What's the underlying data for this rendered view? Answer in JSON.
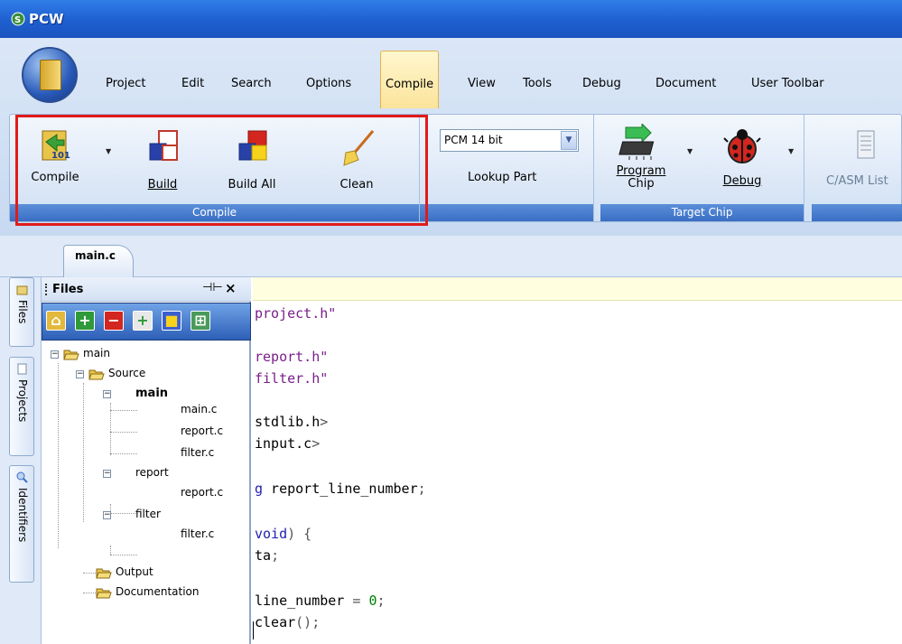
{
  "window": {
    "title": "PCW"
  },
  "menu": {
    "items": [
      "Project",
      "Edit",
      "Search",
      "Options",
      "Compile",
      "View",
      "Tools",
      "Debug",
      "Document",
      "User Toolbar"
    ],
    "active": "Compile"
  },
  "ribbon": {
    "compile_group": {
      "label": "Compile",
      "buttons": {
        "compile": "Compile",
        "build": "Build",
        "build_all": "Build All",
        "clean": "Clean"
      }
    },
    "part_group": {
      "combo_value": "PCM 14 bit",
      "lookup": "Lookup Part"
    },
    "target_group": {
      "label": "Target Chip",
      "program_line1": "Program",
      "program_line2": "Chip",
      "debug": "Debug"
    },
    "listing_group": {
      "label": "C/ASM List"
    }
  },
  "editor_tab": {
    "label": "main.c"
  },
  "side_tabs": [
    "Files",
    "Projects",
    "Identifiers"
  ],
  "files_panel": {
    "title": "Files",
    "pin_icon": "pin-icon",
    "close_icon": "close-icon",
    "tree": [
      {
        "label": "main",
        "level": 0,
        "type": "folder"
      },
      {
        "label": "Source",
        "level": 1,
        "type": "folder"
      },
      {
        "label": "main",
        "level": 2,
        "type": "group",
        "bold": true
      },
      {
        "label": "main.c",
        "level": 3,
        "type": "file"
      },
      {
        "label": "report.c",
        "level": 3,
        "type": "file"
      },
      {
        "label": "filter.c",
        "level": 3,
        "type": "file"
      },
      {
        "label": "report",
        "level": 2,
        "type": "group"
      },
      {
        "label": "report.c",
        "level": 3,
        "type": "file"
      },
      {
        "label": "filter",
        "level": 2,
        "type": "group"
      },
      {
        "label": "filter.c",
        "level": 3,
        "type": "file"
      },
      {
        "label": "Output",
        "level": 1,
        "type": "folder"
      },
      {
        "label": "Documentation",
        "level": 1,
        "type": "folder"
      }
    ]
  },
  "code_lines": [
    {
      "a": "project.h\"",
      "cls": "str"
    },
    {
      "a": ""
    },
    {
      "a": "report.h\"",
      "cls": "str"
    },
    {
      "a": "filter.h\"",
      "cls": "str"
    },
    {
      "a": ""
    },
    {
      "a": "stdlib.h>",
      "cls": "pp"
    },
    {
      "a": "input.c>",
      "cls": "pp"
    },
    {
      "a": ""
    },
    {
      "a": "g report_line_number;"
    },
    {
      "a": ""
    },
    {
      "a": "void) {"
    },
    {
      "a": "ta;"
    },
    {
      "a": ""
    },
    {
      "a": "line_number = 0;"
    },
    {
      "a": "clear();"
    }
  ]
}
